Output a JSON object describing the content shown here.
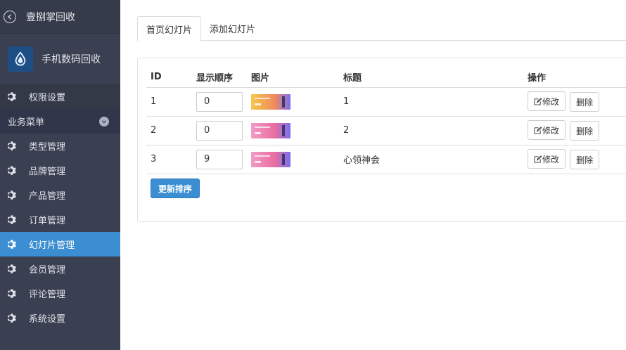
{
  "sidebar": {
    "title": "壹捌掌回收",
    "brand_name": "手机数码回收",
    "permission_label": "权限设置",
    "group_label": "业务菜单",
    "items": [
      {
        "label": "类型管理"
      },
      {
        "label": "品牌管理"
      },
      {
        "label": "产品管理"
      },
      {
        "label": "订单管理"
      },
      {
        "label": "幻灯片管理"
      },
      {
        "label": "会员管理"
      },
      {
        "label": "评论管理"
      },
      {
        "label": "系统设置"
      }
    ],
    "active_item": "幻灯片管理"
  },
  "tabs": [
    {
      "label": "首页幻灯片"
    },
    {
      "label": "添加幻灯片"
    }
  ],
  "table": {
    "headers": [
      "ID",
      "显示顺序",
      "图片",
      "标题",
      "操作"
    ],
    "rows": [
      {
        "id": "1",
        "order": "0",
        "title": "1"
      },
      {
        "id": "2",
        "order": "0",
        "title": "2"
      },
      {
        "id": "3",
        "order": "9",
        "title": "心领神会"
      }
    ],
    "edit_label": "修改",
    "delete_label": "删除"
  },
  "update_button": "更新排序",
  "colors": {
    "sidebar_bg": "#3a3f51",
    "active_bg": "#3a8ed1",
    "primary_button": "#3a8ed1"
  }
}
